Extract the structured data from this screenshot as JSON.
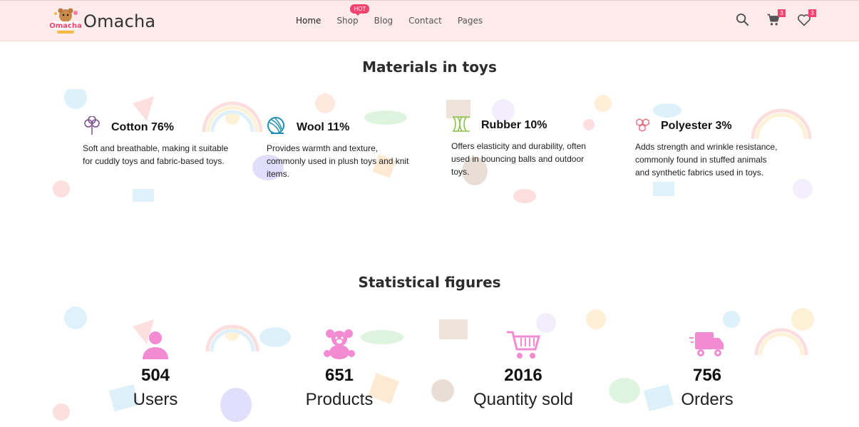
{
  "header": {
    "brand": "Omacha",
    "logo_text": "Omacha",
    "nav": [
      {
        "label": "Home"
      },
      {
        "label": "Shop",
        "badge": "HOT"
      },
      {
        "label": "Blog"
      },
      {
        "label": "Contact"
      },
      {
        "label": "Pages"
      }
    ],
    "cart_count": "3",
    "wishlist_count": "3"
  },
  "materials": {
    "title": "Materials in toys",
    "items": [
      {
        "name": "Cotton 76%",
        "icon": "cotton-flower-icon",
        "desc": "Soft and breathable, making it suitable for cuddly toys and fabric-based toys."
      },
      {
        "name": "Wool 11%",
        "icon": "yarn-ball-icon",
        "desc": "Provides warmth and texture, commonly used in plush toys and knit items."
      },
      {
        "name": "Rubber 10%",
        "icon": "rubber-icon",
        "desc": "Offers elasticity and durability, often used in bouncing balls and outdoor toys."
      },
      {
        "name": "Polyester 3%",
        "icon": "polyester-molecule-icon",
        "desc": "Adds strength and wrinkle resistance, commonly found in stuffed animals and synthetic fabrics used in toys."
      }
    ]
  },
  "stats": {
    "title": "Statistical figures",
    "items": [
      {
        "value": "504",
        "label": "Users",
        "icon": "user-icon"
      },
      {
        "value": "651",
        "label": "Products",
        "icon": "teddy-bear-icon"
      },
      {
        "value": "2016",
        "label": "Quantity sold",
        "icon": "shopping-cart-icon"
      },
      {
        "value": "756",
        "label": "Orders",
        "icon": "delivery-truck-icon"
      }
    ]
  },
  "colors": {
    "accent": "#f0446e",
    "header_bg": "#fdeaea",
    "stat_icon": "#f38bd3"
  }
}
